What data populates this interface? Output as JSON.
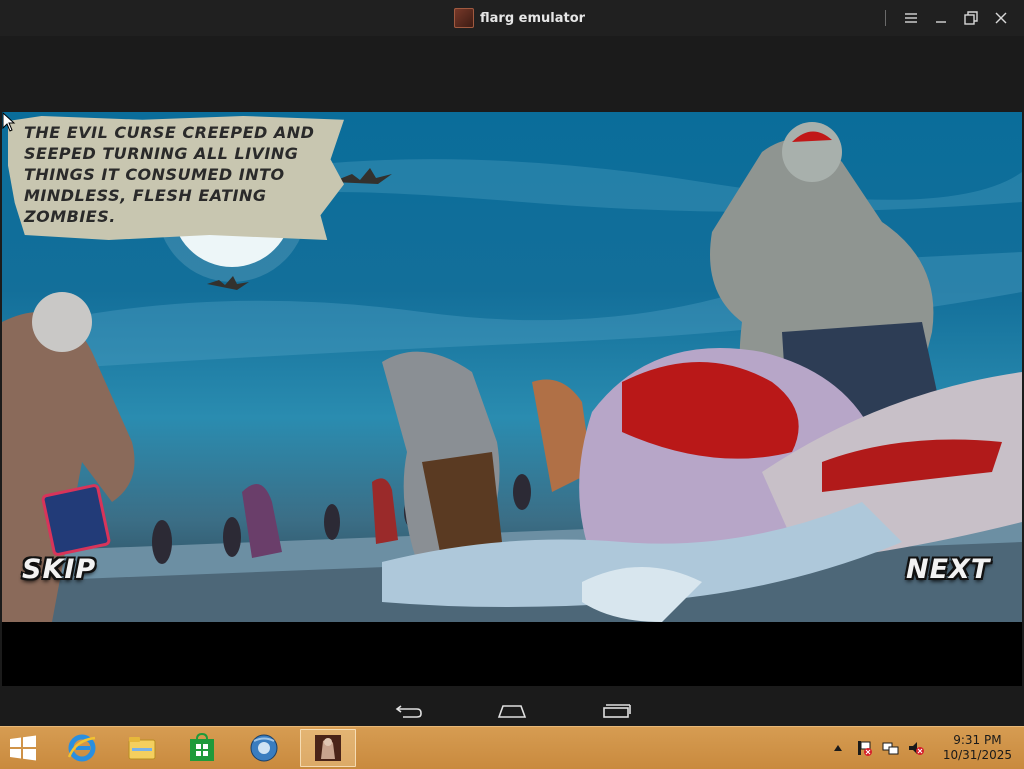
{
  "window": {
    "title": "flarg emulator"
  },
  "game": {
    "caption": "The evil curse creeped and\nseeped turning all living\nthings it consumed into\nmindless, flesh eating\nzombies.",
    "skip_label": "SKIP",
    "next_label": "NEXT"
  },
  "taskbar": {
    "apps": [
      "internet-explorer",
      "file-explorer",
      "store",
      "browser",
      "flarg-emulator"
    ],
    "clock_time": "9:31 PM",
    "clock_date": "10/31/2025"
  },
  "colors": {
    "taskbar": "#c98a3e",
    "titlebar": "#202020",
    "sky": "#136f9a"
  }
}
